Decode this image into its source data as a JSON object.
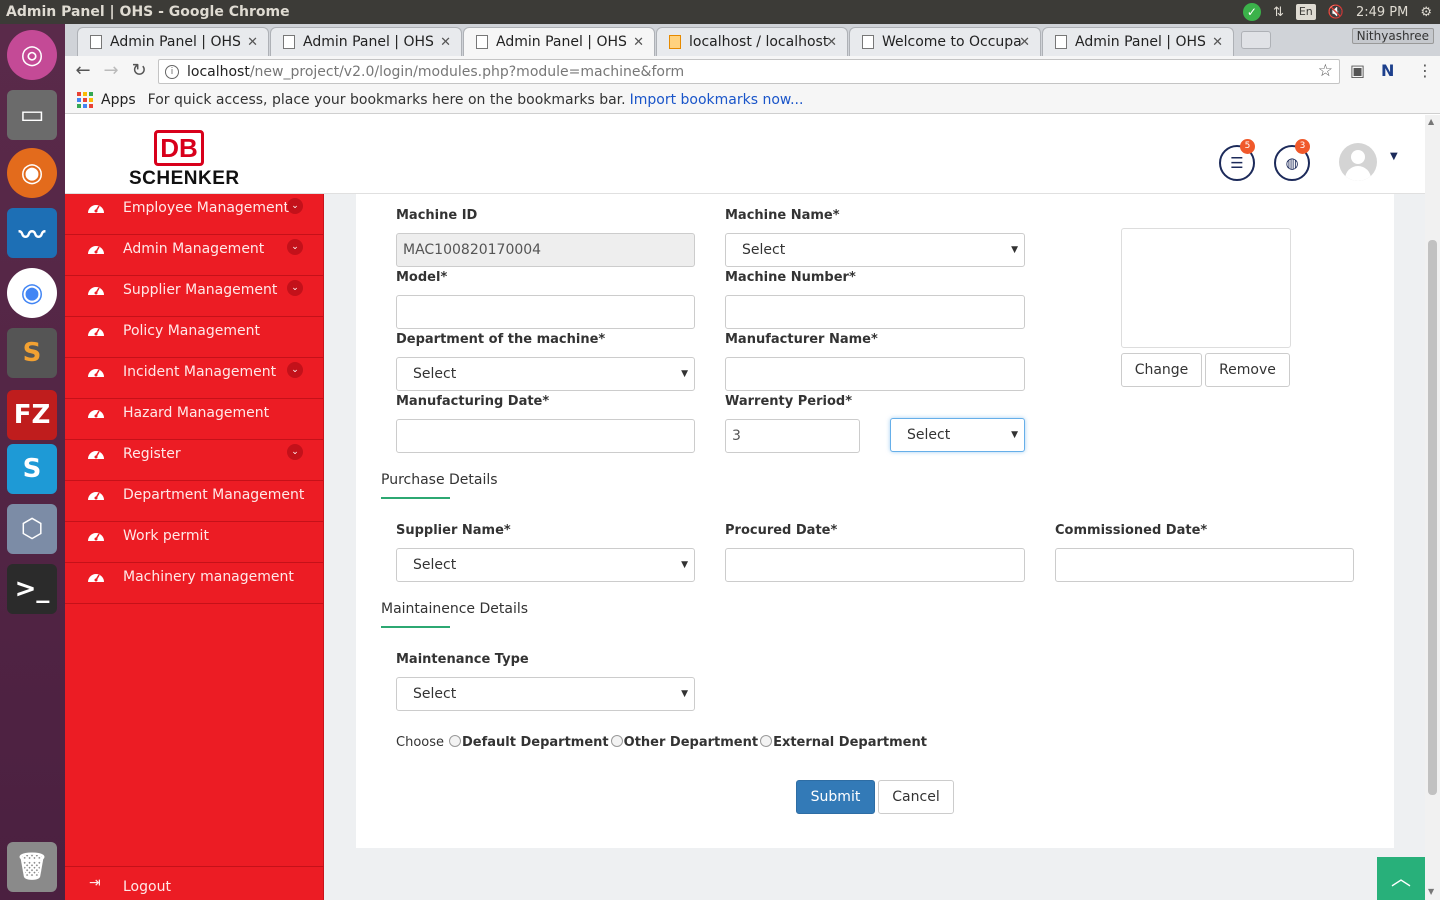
{
  "window": {
    "title": "Admin Panel | OHS - Google Chrome",
    "time": "2:49 PM",
    "lang": "En"
  },
  "tabs": [
    {
      "label": "Admin Panel | OHS"
    },
    {
      "label": "Admin Panel | OHS"
    },
    {
      "label": "Admin Panel | OHS"
    },
    {
      "label": "localhost / localhost"
    },
    {
      "label": "Welcome to Occupational"
    },
    {
      "label": "Admin Panel | OHS"
    }
  ],
  "profile": "Nithyashree",
  "omnibox": {
    "host": "localhost",
    "path": "/new_project/v2.0/login/modules.php?module=machine&form"
  },
  "bookmarks": {
    "apps": "Apps",
    "hint": "For quick access, place your bookmarks here on the bookmarks bar.",
    "link": "Import bookmarks now..."
  },
  "brand": {
    "mark": "DB",
    "name": "SCHENKER"
  },
  "header": {
    "badge_list": "5",
    "badge_globe": "3"
  },
  "sidebar": {
    "items": [
      {
        "label": "Employee Management",
        "has_children": true
      },
      {
        "label": "Admin Management",
        "has_children": true
      },
      {
        "label": "Supplier Management",
        "has_children": true
      },
      {
        "label": "Policy Management",
        "has_children": false
      },
      {
        "label": "Incident Management",
        "has_children": true
      },
      {
        "label": "Hazard Management",
        "has_children": false
      },
      {
        "label": "Register",
        "has_children": true
      },
      {
        "label": "Department Management",
        "has_children": false
      },
      {
        "label": "Work permit",
        "has_children": false
      },
      {
        "label": "Machinery management",
        "has_children": false
      }
    ],
    "logout": "Logout"
  },
  "form": {
    "machine_id": {
      "label": "Machine ID",
      "value": "MAC100820170004"
    },
    "machine_name": {
      "label": "Machine Name*",
      "value": "Select"
    },
    "model": {
      "label": "Model*",
      "value": ""
    },
    "machine_number": {
      "label": "Machine Number*",
      "value": ""
    },
    "department": {
      "label": "Department of the machine*",
      "value": "Select"
    },
    "manufacturer": {
      "label": "Manufacturer Name*",
      "value": ""
    },
    "mfg_date": {
      "label": "Manufacturing Date*",
      "value": ""
    },
    "warranty": {
      "label": "Warrenty Period*",
      "value": "3",
      "unit": "Select"
    },
    "photo": {
      "change": "Change",
      "remove": "Remove"
    },
    "purchase_section": "Purchase Details",
    "supplier": {
      "label": "Supplier Name*",
      "value": "Select"
    },
    "procured": {
      "label": "Procured Date*",
      "value": ""
    },
    "commissioned": {
      "label": "Commissioned Date*",
      "value": ""
    },
    "maintenance_section": "Maintainence Details",
    "maintenance_type": {
      "label": "Maintenance Type",
      "value": "Select"
    },
    "choose": {
      "label": "Choose",
      "options": [
        "Default Department",
        "Other Department",
        "External Department"
      ]
    },
    "submit": "Submit",
    "cancel": "Cancel"
  },
  "colors": {
    "sidebar": "#ec1c24",
    "primary": "#337ab7",
    "accent": "#2ca872",
    "header_icons": "#1c2a5a"
  }
}
